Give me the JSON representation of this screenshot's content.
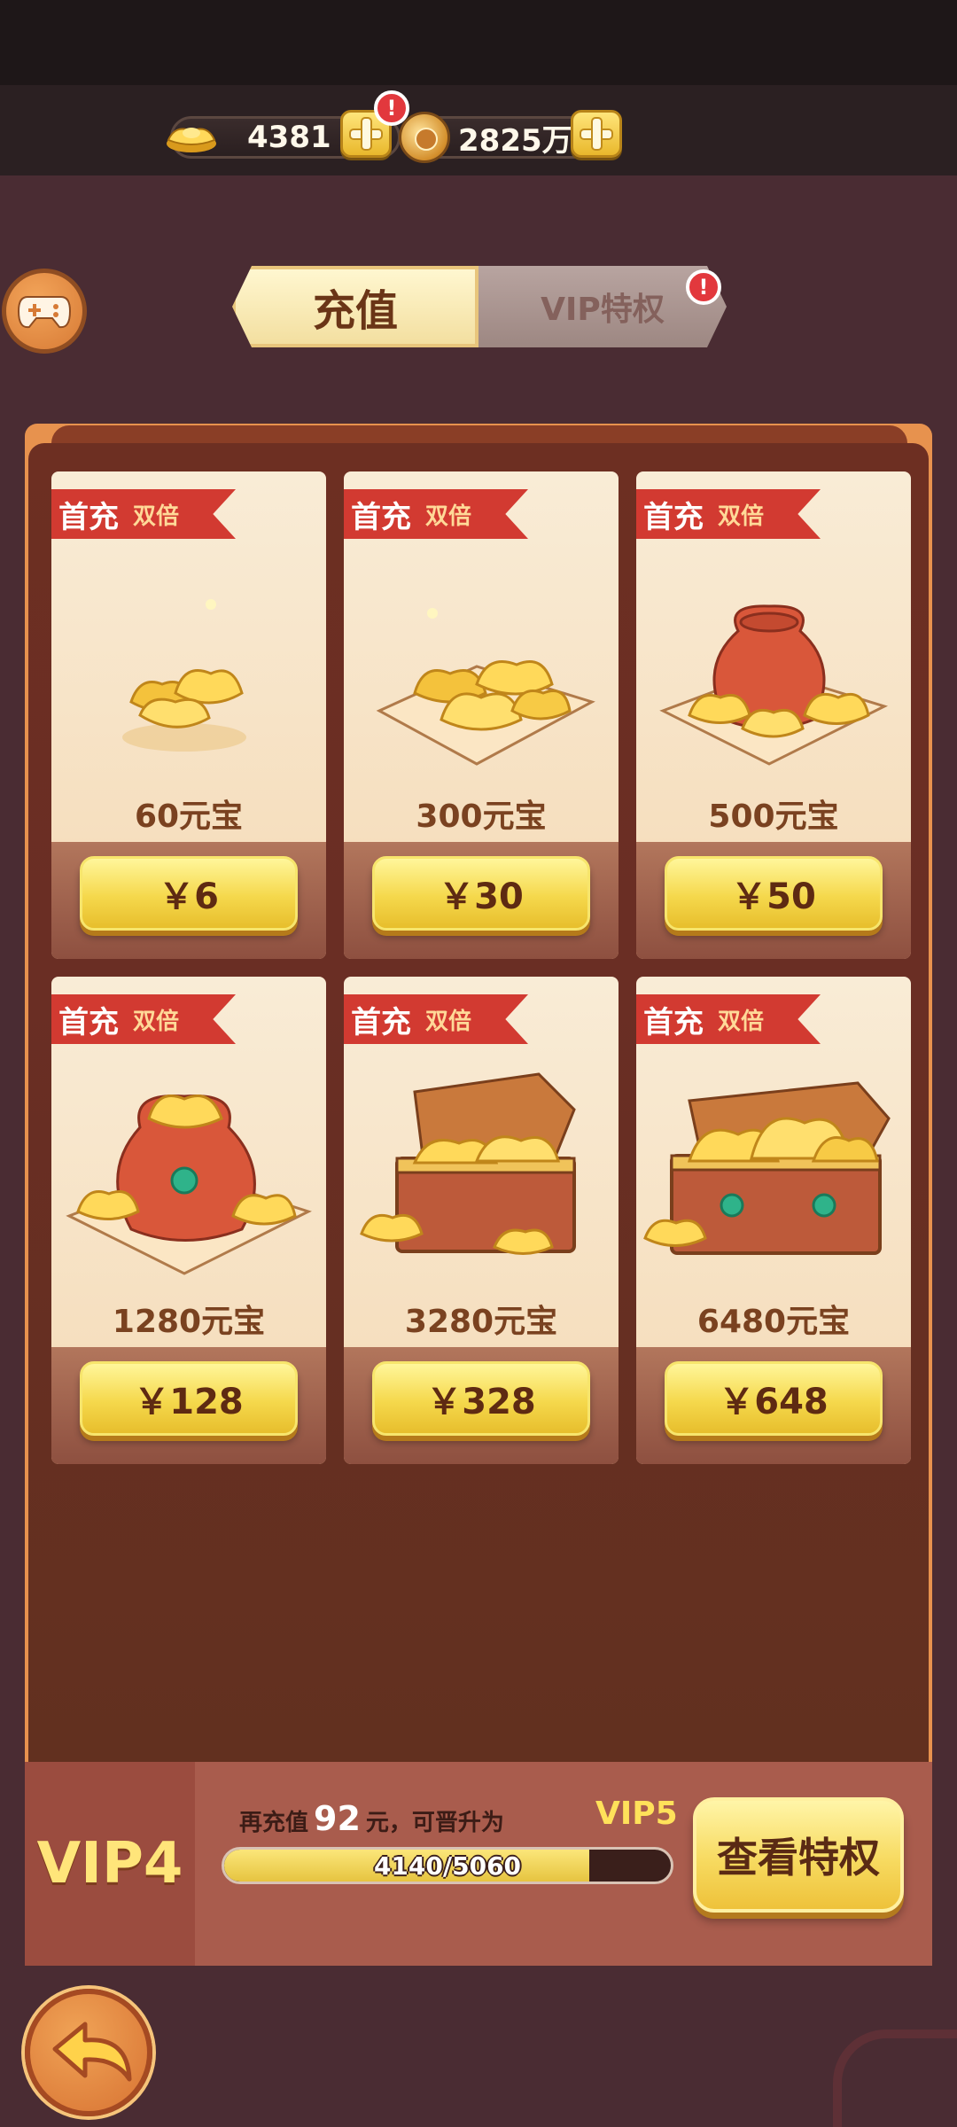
{
  "currency": {
    "ingots": "4381",
    "coins": "2825万",
    "alert": "!"
  },
  "tabs": {
    "recharge": "充值",
    "vip": "VIP特权",
    "vip_alert": "!"
  },
  "packages": [
    {
      "ribbon_first": "首充",
      "ribbon_double": "双倍",
      "amount": "60元宝",
      "price": "￥6",
      "art": "small-ingot-pile"
    },
    {
      "ribbon_first": "首充",
      "ribbon_double": "双倍",
      "amount": "300元宝",
      "price": "￥30",
      "art": "ingots-on-cloth"
    },
    {
      "ribbon_first": "首充",
      "ribbon_double": "双倍",
      "amount": "500元宝",
      "price": "￥50",
      "art": "money-bag-with-ingots"
    },
    {
      "ribbon_first": "首充",
      "ribbon_double": "双倍",
      "amount": "1280元宝",
      "price": "￥128",
      "art": "large-money-bag"
    },
    {
      "ribbon_first": "首充",
      "ribbon_double": "双倍",
      "amount": "3280元宝",
      "price": "￥328",
      "art": "treasure-chest"
    },
    {
      "ribbon_first": "首充",
      "ribbon_double": "双倍",
      "amount": "6480元宝",
      "price": "￥648",
      "art": "large-treasure-chest"
    }
  ],
  "vip": {
    "current": "VIP4",
    "prefix": "再充值",
    "remaining": "92",
    "suffix": "元，可晋升为",
    "next": "VIP5",
    "progress_text": "4140/5060",
    "progress_value": 4140,
    "progress_max": 5060,
    "view_button": "查看特权"
  },
  "colors": {
    "background": "#4a2c33",
    "panel": "#6d2f22",
    "button_yellow": "#f5d84c",
    "ribbon_red": "#d23a31",
    "vip_gold": "#ffe57a"
  }
}
